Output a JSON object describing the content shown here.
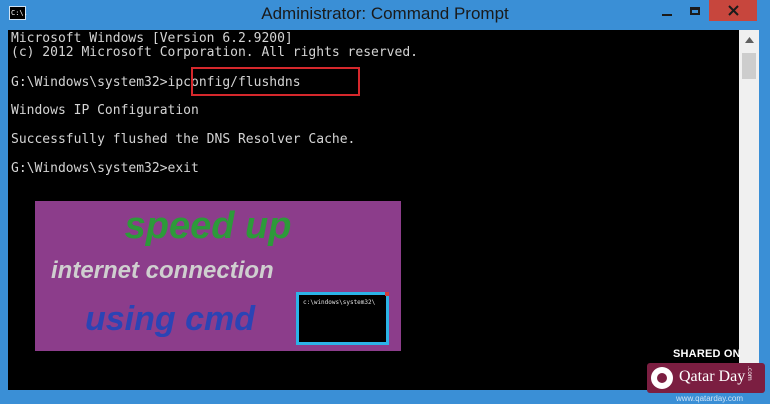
{
  "window": {
    "title": "Administrator: Command Prompt",
    "app_icon_text": "C:\\."
  },
  "console": {
    "lines": [
      "Microsoft Windows [Version 6.2.9200]",
      "(c) 2012 Microsoft Corporation. All rights reserved.",
      "G:\\Windows\\system32>ipconfig/flushdns",
      "Windows IP Configuration",
      "Successfully flushed the DNS Resolver Cache.",
      "G:\\Windows\\system32>exit"
    ],
    "highlighted_command": "ipconfig/flushdns"
  },
  "overlay": {
    "line1": "speed up",
    "line2": "internet connection",
    "line3": "using cmd",
    "mini_console_text": "c:\\windows\\system32\\"
  },
  "watermark": {
    "shared_on": "SHARED ON",
    "brand": "Qatar Day",
    "brand_suffix": ".com",
    "url": "www.qatarday.com"
  },
  "colors": {
    "title_bar": "#3a8fd6",
    "close_button": "#c7463d",
    "highlight_box": "#d6282c",
    "banner_bg": "#8c3d8b",
    "brand_bg": "#7b1e41"
  }
}
